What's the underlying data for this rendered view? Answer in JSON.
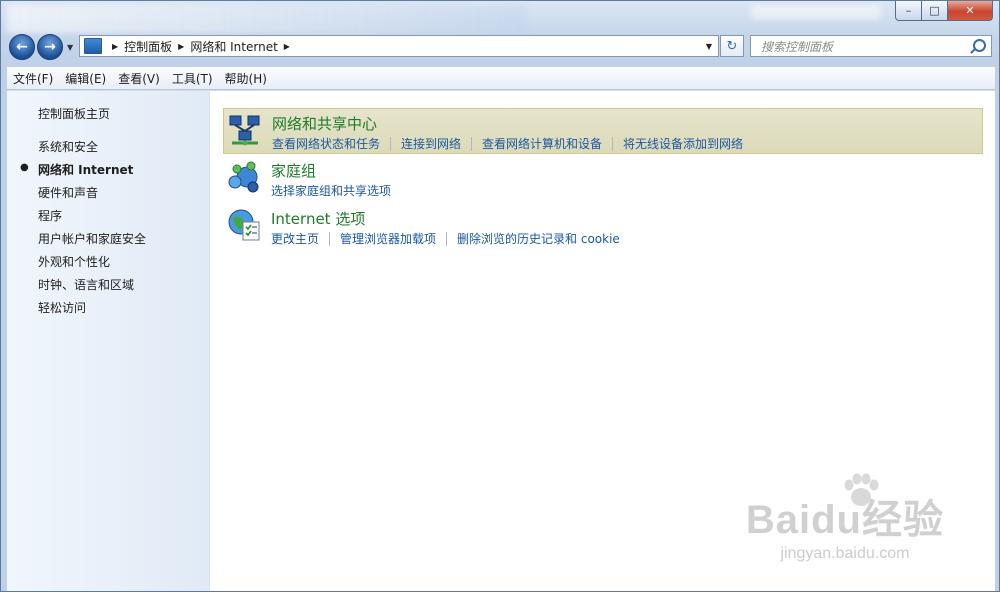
{
  "window": {
    "caption": {
      "minimize": "–",
      "maximize": "□",
      "close": "✕"
    }
  },
  "nav": {
    "back_icon": "back-arrow-icon",
    "forward_icon": "forward-arrow-icon",
    "back_glyph": "←",
    "forward_glyph": "→",
    "dropdown_glyph": "▼"
  },
  "address": {
    "crumbs": [
      "控制面板",
      "网络和 Internet"
    ],
    "sep": "▶",
    "dropdown": "▼",
    "refresh_glyph": "↻"
  },
  "search": {
    "placeholder": "搜索控制面板"
  },
  "menu": [
    "文件(F)",
    "编辑(E)",
    "查看(V)",
    "工具(T)",
    "帮助(H)"
  ],
  "sidebar": {
    "home": "控制面板主页",
    "items": [
      {
        "label": "系统和安全",
        "current": false
      },
      {
        "label": "网络和 Internet",
        "current": true
      },
      {
        "label": "硬件和声音",
        "current": false
      },
      {
        "label": "程序",
        "current": false
      },
      {
        "label": "用户帐户和家庭安全",
        "current": false
      },
      {
        "label": "外观和个性化",
        "current": false
      },
      {
        "label": "时钟、语言和区域",
        "current": false
      },
      {
        "label": "轻松访问",
        "current": false
      }
    ],
    "bullet": "●"
  },
  "categories": [
    {
      "title": "网络和共享中心",
      "icon": "network-sharing-icon",
      "selected": true,
      "links": [
        "查看网络状态和任务",
        "连接到网络",
        "查看网络计算机和设备",
        "将无线设备添加到网络"
      ]
    },
    {
      "title": "家庭组",
      "icon": "homegroup-icon",
      "selected": false,
      "links": [
        "选择家庭组和共享选项"
      ]
    },
    {
      "title": "Internet 选项",
      "icon": "internet-options-icon",
      "selected": false,
      "links": [
        "更改主页",
        "管理浏览器加载项",
        "删除浏览的历史记录和 cookie"
      ]
    }
  ],
  "watermark": {
    "logo": "Baidu经验",
    "url": "jingyan.baidu.com"
  },
  "colors": {
    "title_green": "#1e7b2b",
    "link_blue": "#1b58a4",
    "selected_bg": "#e6e4cc"
  }
}
